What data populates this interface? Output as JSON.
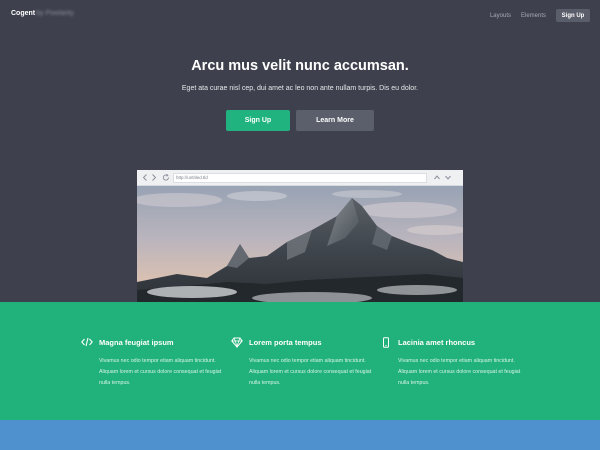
{
  "header": {
    "brand": "Cogent",
    "brand_suffix": "by Pixelarity",
    "nav": [
      {
        "label": "Layouts"
      },
      {
        "label": "Elements"
      }
    ],
    "signup_label": "Sign Up"
  },
  "hero": {
    "title": "Arcu mus velit nunc accumsan.",
    "subtitle": "Eget ata curae nisl cep, dui amet ac leo non ante nullam turpis. Dis eu dolor.",
    "primary_button": "Sign Up",
    "secondary_button": "Learn More"
  },
  "browser": {
    "url": "http://untitled.tld",
    "back_icon": "chevron-left-icon",
    "forward_icon": "chevron-right-icon",
    "reload_icon": "reload-icon"
  },
  "features": [
    {
      "icon": "code-icon",
      "title": "Magna feugiat ipsum",
      "body": "Vivamus nec odio tempor etiam aliquam tincidunt. Aliquam lorem et cursus dolore consequat et feugiat nulla tempus."
    },
    {
      "icon": "diamond-icon",
      "title": "Lorem porta tempus",
      "body": "Vivamus nec odio tempor etiam aliquam tincidunt. Aliquam lorem et cursus dolore consequat et feugiat nulla tempus."
    },
    {
      "icon": "mobile-icon",
      "title": "Lacinia amet rhoncus",
      "body": "Vivamus nec odio tempor etiam aliquam tincidunt. Aliquam lorem et cursus dolore consequat et feugiat nulla tempus."
    }
  ],
  "colors": {
    "hero_bg": "#3e414d",
    "accent": "#21b27b",
    "secondary_button": "#5b5e6b",
    "footer_band": "#4f90ce"
  }
}
